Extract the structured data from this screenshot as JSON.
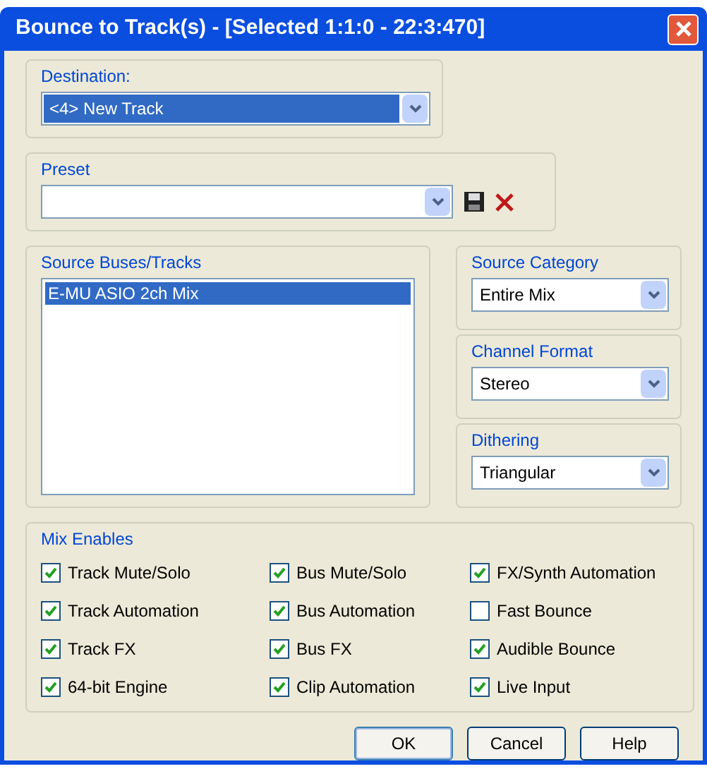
{
  "window": {
    "title": "Bounce to Track(s) - [Selected 1:1:0 - 22:3:470]"
  },
  "destination": {
    "label": "Destination:",
    "value": "<4> New Track"
  },
  "preset": {
    "label": "Preset"
  },
  "source_tracks": {
    "label": "Source Buses/Tracks",
    "items": [
      {
        "label": "E-MU ASIO 2ch Mix",
        "selected": true
      }
    ]
  },
  "source_category": {
    "label": "Source Category",
    "value": "Entire Mix"
  },
  "channel_format": {
    "label": "Channel Format",
    "value": "Stereo"
  },
  "dithering": {
    "label": "Dithering",
    "value": "Triangular"
  },
  "mix_enables": {
    "label": "Mix Enables",
    "options": [
      {
        "label": "Track Mute/Solo",
        "checked": true
      },
      {
        "label": "Bus Mute/Solo",
        "checked": true
      },
      {
        "label": "FX/Synth Automation",
        "checked": true
      },
      {
        "label": "Track Automation",
        "checked": true
      },
      {
        "label": "Bus Automation",
        "checked": true
      },
      {
        "label": "Fast Bounce",
        "checked": false
      },
      {
        "label": "Track FX",
        "checked": true
      },
      {
        "label": "Bus FX",
        "checked": true
      },
      {
        "label": "Audible Bounce",
        "checked": true
      },
      {
        "label": "64-bit Engine",
        "checked": true
      },
      {
        "label": "Clip Automation",
        "checked": true
      },
      {
        "label": "Live Input",
        "checked": true
      }
    ]
  },
  "buttons": [
    "OK",
    "Cancel",
    "Help"
  ]
}
